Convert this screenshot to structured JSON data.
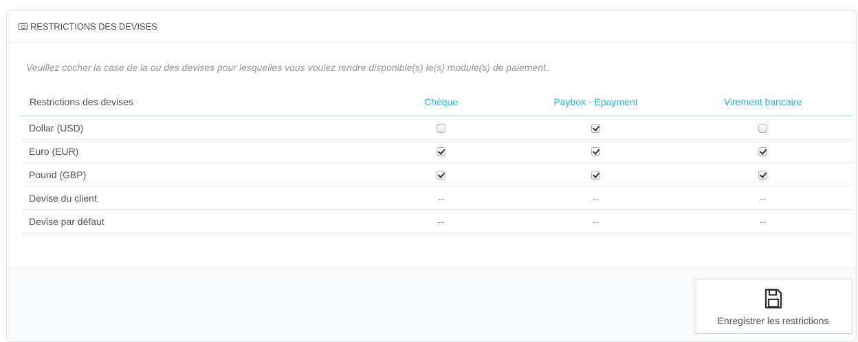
{
  "panel": {
    "title": "Restrictions des devises",
    "info": "Veuillez cocher la case de la ou des devises pour lesquelles vous voulez rendre disponible(s) le(s) module(s) de paiement."
  },
  "table": {
    "header_label": "Restrictions des devises",
    "modules": [
      "Chèque",
      "Paybox - Epayment",
      "Virement bancaire"
    ],
    "rows": [
      {
        "label": "Dollar (USD)",
        "checked": [
          false,
          true,
          false
        ]
      },
      {
        "label": "Euro (EUR)",
        "checked": [
          true,
          true,
          true
        ]
      },
      {
        "label": "Pound (GBP)",
        "checked": [
          true,
          true,
          true
        ]
      },
      {
        "label": "Devise du client",
        "values": [
          "--",
          "--",
          "--"
        ]
      },
      {
        "label": "Devise par défaut",
        "values": [
          "--",
          "--",
          "--"
        ]
      }
    ]
  },
  "footer": {
    "save_label": "Enregistrer les restrictions",
    "save_icon": "floppy-disk-icon"
  },
  "colors": {
    "accent": "#25b9d7"
  }
}
